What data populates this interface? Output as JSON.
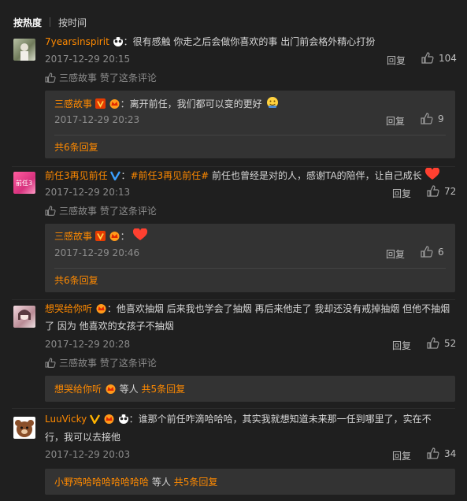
{
  "tabs": [
    "按热度",
    "按时间"
  ],
  "comments": [
    {
      "user": "7yearsinspirit",
      "text": "：很有感触 你走之后会做你喜欢的事 出门前会格外精心打扮",
      "time": "2017-12-29 20:15",
      "reply": "回复",
      "likes": "104",
      "liked_by": "三感故事 赞了这条评论",
      "sub_reply": {
        "user": "三感故事",
        "text": "：离开前任，我们都可以变的更好",
        "time": "2017-12-29 20:23",
        "reply": "回复",
        "likes": "9"
      },
      "more": "共6条回复"
    },
    {
      "user": "前任3再见前任",
      "hashtag": "#前任3再见前任#",
      "text_pre": "：",
      "text": " 前任也曾经是对的人，感谢TA的陪伴，让自己成长",
      "time": "2017-12-29 20:13",
      "reply": "回复",
      "likes": "72",
      "liked_by": "三感故事 赞了这条评论",
      "sub_reply": {
        "user": "三感故事",
        "text": "：",
        "time": "2017-12-29 20:46",
        "reply": "回复",
        "likes": "6"
      },
      "more": "共6条回复"
    },
    {
      "user": "想哭给你听",
      "text_line1": "：他喜欢抽烟 后来我也学会了抽烟 再后来他走了 我却还没有戒掉抽烟 但他不抽烟",
      "text_line2": "了 因为 他喜欢的女孩子不抽烟",
      "time": "2017-12-29 20:28",
      "reply": "回复",
      "likes": "52",
      "liked_by": "三感故事 赞了这条评论",
      "summary_user": "想哭给你听",
      "summary_mid": "等人",
      "summary_more": "共5条回复"
    },
    {
      "user": "LuuVicky",
      "text_line1": "：谁那个前任咋滴哈哈哈，其实我就想知道未来那一任到哪里了，实在不",
      "text_line2": "行，我可以去接他",
      "time": "2017-12-29 20:03",
      "reply": "回复",
      "likes": "34",
      "summary_user": "小野鸡哈哈哈哈哈哈哈",
      "summary_mid": "等人",
      "summary_more": "共5条回复"
    }
  ]
}
